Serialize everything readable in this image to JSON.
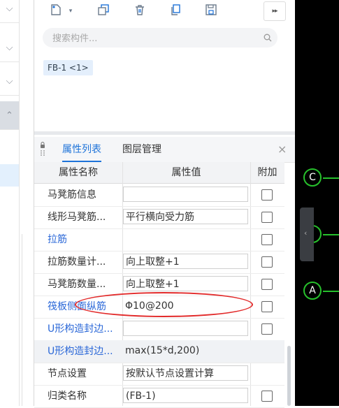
{
  "toolbar": {
    "icons": [
      "new-component-icon",
      "dropdown-arrow-icon",
      "copy-icon",
      "delete-icon",
      "duplicate-icon",
      "save-icon",
      "more-icon"
    ],
    "more_label": "▸▸"
  },
  "search": {
    "placeholder": "搜索构件...",
    "value": ""
  },
  "component_list": [
    {
      "label": "FB-1 <1>"
    }
  ],
  "panel_tabs": [
    {
      "label": "属性列表",
      "active": true
    },
    {
      "label": "图层管理",
      "active": false
    }
  ],
  "close_label": "×",
  "table": {
    "headers": [
      "属性名称",
      "属性值",
      "附加"
    ],
    "rows": [
      {
        "name": "马凳筋信息",
        "value": "",
        "blue": false,
        "checkbox": true,
        "value_box": true
      },
      {
        "name": "线形马凳筋...",
        "value": "平行横向受力筋",
        "blue": false,
        "checkbox": true,
        "value_box": true
      },
      {
        "name": "拉筋",
        "value": "",
        "blue": true,
        "checkbox": true,
        "value_box": false
      },
      {
        "name": "拉筋数量计...",
        "value": "向上取整+1",
        "blue": false,
        "checkbox": true,
        "value_box": true
      },
      {
        "name": "马凳筋数量...",
        "value": "向上取整+1",
        "blue": false,
        "checkbox": true,
        "value_box": true
      },
      {
        "name": "筏板侧面纵筋",
        "value": "Φ10@200",
        "blue": true,
        "checkbox": true,
        "value_box": false
      },
      {
        "name": "U形构造封边...",
        "value": "",
        "blue": true,
        "checkbox": true,
        "value_box": true
      },
      {
        "name": "U形构造封边...",
        "value": "max(15*d,200)",
        "blue": true,
        "checkbox": false,
        "value_box": false,
        "highlight": true
      },
      {
        "name": "节点设置",
        "value": "按默认节点设置计算",
        "blue": false,
        "checkbox": false,
        "value_box": true
      },
      {
        "name": "归类名称",
        "value": "(FB-1)",
        "blue": false,
        "checkbox": true,
        "value_box": true
      }
    ]
  },
  "axes": [
    {
      "label": "C"
    },
    {
      "label": ""
    },
    {
      "label": "A"
    }
  ],
  "colors": {
    "accent": "#1e73d9",
    "annotation": "#e22a2a",
    "axis": "#27c02c"
  }
}
